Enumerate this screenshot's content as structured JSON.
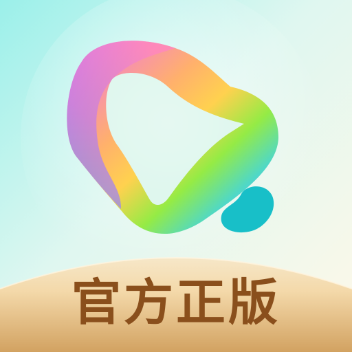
{
  "app_icon": {
    "badge_text": "官方正版",
    "colors": {
      "background_start": "#a9f0ec",
      "background_end": "#fff7e3",
      "ribbon_top": "#f4dfb7",
      "ribbon_bottom": "#d6a86a",
      "badge_text": "#8a4f1c",
      "logo_pink": "#f37fd4",
      "logo_orange": "#ffcd58",
      "logo_green": "#95eb45",
      "logo_cyan": "#4ad8d1",
      "logo_blue": "#6f9dff",
      "dot": "#18bfc8"
    },
    "icons": [
      "bell-logo-icon",
      "bean-dot-icon"
    ]
  }
}
